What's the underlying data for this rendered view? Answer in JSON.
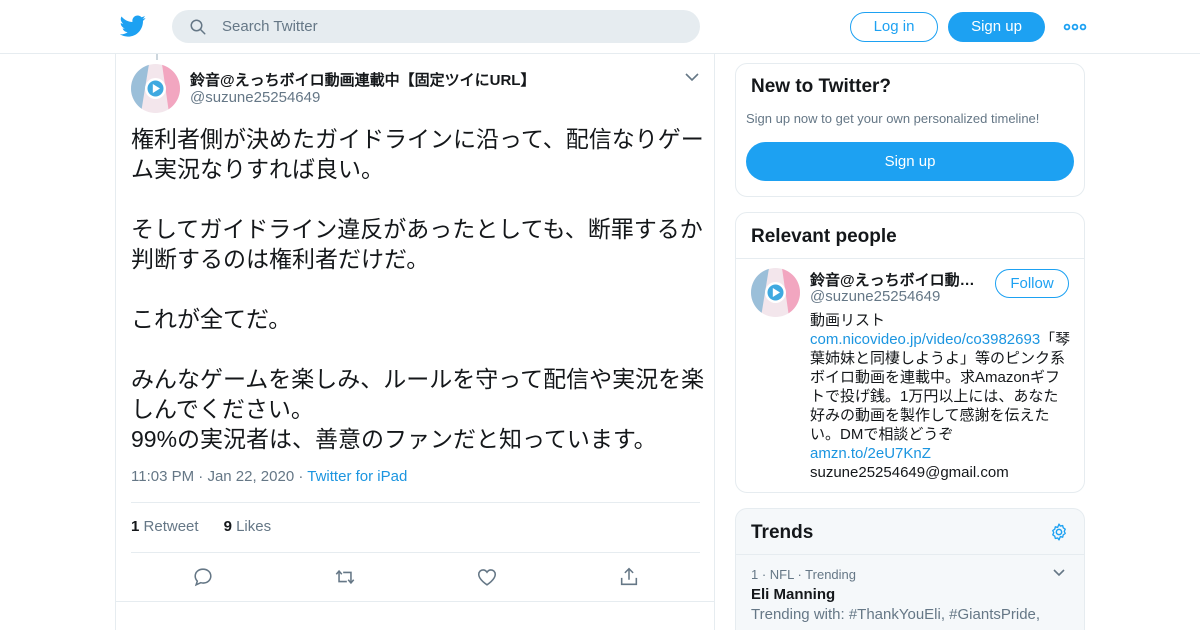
{
  "topbar": {
    "logo_icon": "twitter-bird-icon",
    "search_placeholder": "Search Twitter",
    "login_label": "Log in",
    "signup_label": "Sign up",
    "more_icon": "more-dots-icon"
  },
  "tweet": {
    "display_name": "鈴音@えっちボイロ動画連載中【固定ツイにURL】",
    "handle": "@suzune25254649",
    "text": "権利者側が決めたガイドラインに沿って、配信なりゲーム実況なりすれば良い。\n\nそしてガイドライン違反があったとしても、断罪するか判断するのは権利者だけだ。\n\nこれが全てだ。\n\nみんなゲームを楽しみ、ルールを守って配信や実況を楽しんでください。\n99%の実況者は、善意のファンだと知っています。",
    "time": "11:03 PM",
    "date": "Jan 22, 2020",
    "source": "Twitter for iPad",
    "dot": "·",
    "retweets_count": "1",
    "retweets_label": "Retweet",
    "likes_count": "9",
    "likes_label": "Likes"
  },
  "new_to_twitter": {
    "title": "New to Twitter?",
    "subtitle": "Sign up now to get your own personalized timeline!",
    "signup_label": "Sign up"
  },
  "relevant_people": {
    "title": "Relevant people",
    "name": "鈴音@えっちボイロ動画連載中【固定ツイにURL】",
    "handle": "@suzune25254649",
    "follow_label": "Follow",
    "bio_start": "動画リスト",
    "bio_link1": "com.nicovideo.jp/video/co3982693",
    "bio_middle": "「琴葉姉妹と同棲しようよ」等のピンク系ボイロ動画を連載中。求Amazonギフトで投げ銭。1万円以上には、あなた好みの動画を製作して感謝を伝えたい。DMで相談どうぞ",
    "bio_link2": "amzn.to/2eU7KnZ",
    "bio_email": "suzune25254649@gmail.com"
  },
  "trends": {
    "title": "Trends",
    "items": [
      {
        "meta": "1 · NFL · Trending",
        "name": "Eli Manning",
        "with": "Trending with: #ThankYouEli, #GiantsPride,"
      }
    ]
  },
  "colors": {
    "accent": "#1da1f2",
    "link": "#1b95e0",
    "muted": "#657786"
  }
}
